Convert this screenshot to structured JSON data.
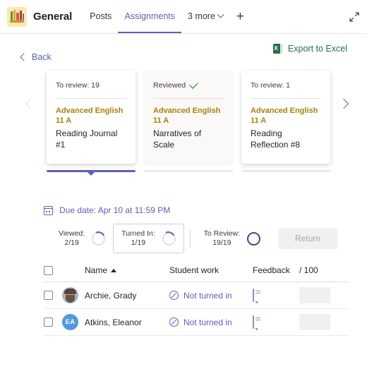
{
  "header": {
    "team_icon": "bookshelf-icon",
    "team_name": "General",
    "tabs": [
      {
        "label": "Posts",
        "active": false
      },
      {
        "label": "Assignments",
        "active": true
      }
    ],
    "more_label": "3 more",
    "add_tab_label": "+",
    "expand_icon": "expand-diagonal-icon"
  },
  "toolbar": {
    "back_label": "Back",
    "export_label": "Export to Excel",
    "excel_icon_letter": "X"
  },
  "carousel": {
    "prev_label": "‹",
    "next_label": "›",
    "cards": [
      {
        "status": "To review: 19",
        "reviewed": false,
        "course": "Advanced English 11 A",
        "title": "Reading Journal #1",
        "selected": true
      },
      {
        "status": "Reviewed",
        "reviewed": true,
        "course": "Advanced English 11 A",
        "title": "Narratives of Scale",
        "selected": false
      },
      {
        "status": "To review: 1",
        "reviewed": false,
        "course": "Advanced English 11 A",
        "title": "Reading Reflection #8",
        "selected": false
      }
    ]
  },
  "due_date": {
    "text": "Due date: Apr 10 at 11:59 PM",
    "icon": "calendar-icon"
  },
  "status_strip": {
    "viewed": {
      "label": "Viewed:",
      "value": "2/19"
    },
    "turned_in": {
      "label": "Turned In:",
      "value": "1/19"
    },
    "to_review": {
      "label": "To Review:",
      "value": "19/19"
    },
    "return_button": "Return"
  },
  "table": {
    "headers": {
      "name": "Name",
      "student_work": "Student work",
      "feedback": "Feedback",
      "points": "/ 100"
    },
    "rows": [
      {
        "name": "Archie, Grady",
        "avatar_type": "photo",
        "initials": "",
        "work_status": "Not turned in",
        "grade": ""
      },
      {
        "name": "Atkins, Eleanor",
        "avatar_type": "initials",
        "initials": "EA",
        "work_status": "Not turned in",
        "grade": ""
      }
    ]
  },
  "colors": {
    "accent_purple": "#5b5fc7",
    "deep_purple": "#444791",
    "excel_green": "#217346",
    "course_gold": "#ab8104",
    "check_green": "#107c10",
    "avatar_blue": "#4e9ae0"
  }
}
